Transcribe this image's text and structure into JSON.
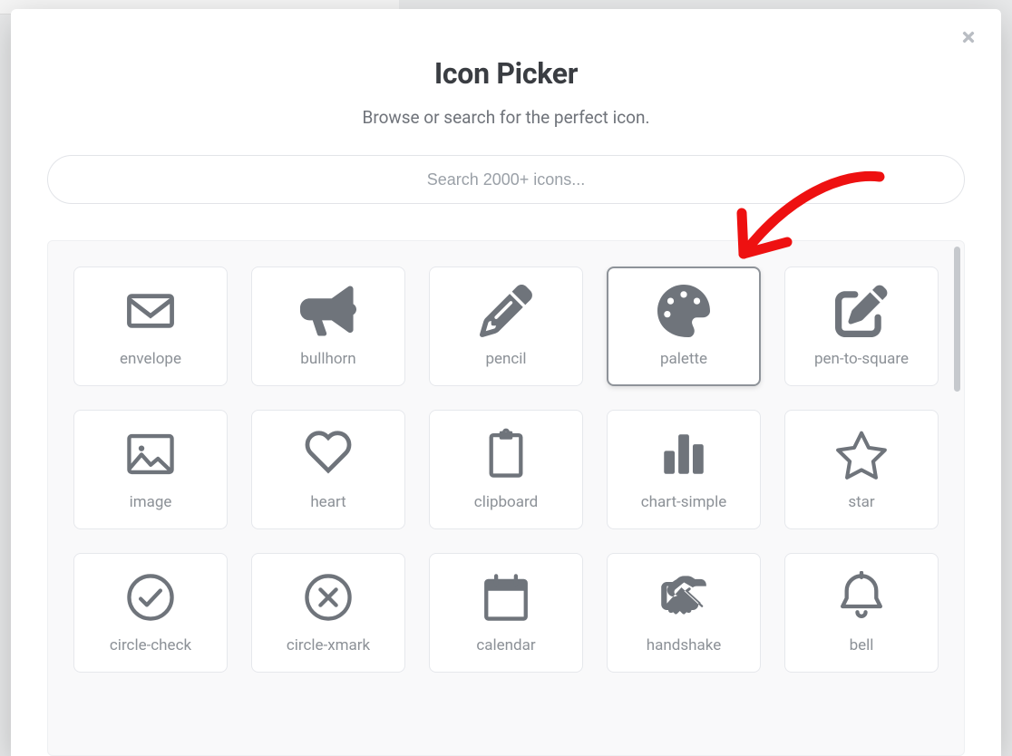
{
  "modal": {
    "title": "Icon Picker",
    "subtitle": "Browse or search for the perfect icon."
  },
  "search": {
    "placeholder": "Search 2000+ icons..."
  },
  "icons": [
    {
      "id": "envelope",
      "label": "envelope",
      "selected": false
    },
    {
      "id": "bullhorn",
      "label": "bullhorn",
      "selected": false
    },
    {
      "id": "pencil",
      "label": "pencil",
      "selected": false
    },
    {
      "id": "palette",
      "label": "palette",
      "selected": true
    },
    {
      "id": "pen-to-square",
      "label": "pen-to-square",
      "selected": false
    },
    {
      "id": "image",
      "label": "image",
      "selected": false
    },
    {
      "id": "heart",
      "label": "heart",
      "selected": false
    },
    {
      "id": "clipboard",
      "label": "clipboard",
      "selected": false
    },
    {
      "id": "chart-simple",
      "label": "chart-simple",
      "selected": false
    },
    {
      "id": "star",
      "label": "star",
      "selected": false
    },
    {
      "id": "circle-check",
      "label": "circle-check",
      "selected": false
    },
    {
      "id": "circle-xmark",
      "label": "circle-xmark",
      "selected": false
    },
    {
      "id": "calendar",
      "label": "calendar",
      "selected": false
    },
    {
      "id": "handshake",
      "label": "handshake",
      "selected": false
    },
    {
      "id": "bell",
      "label": "bell",
      "selected": false
    }
  ]
}
